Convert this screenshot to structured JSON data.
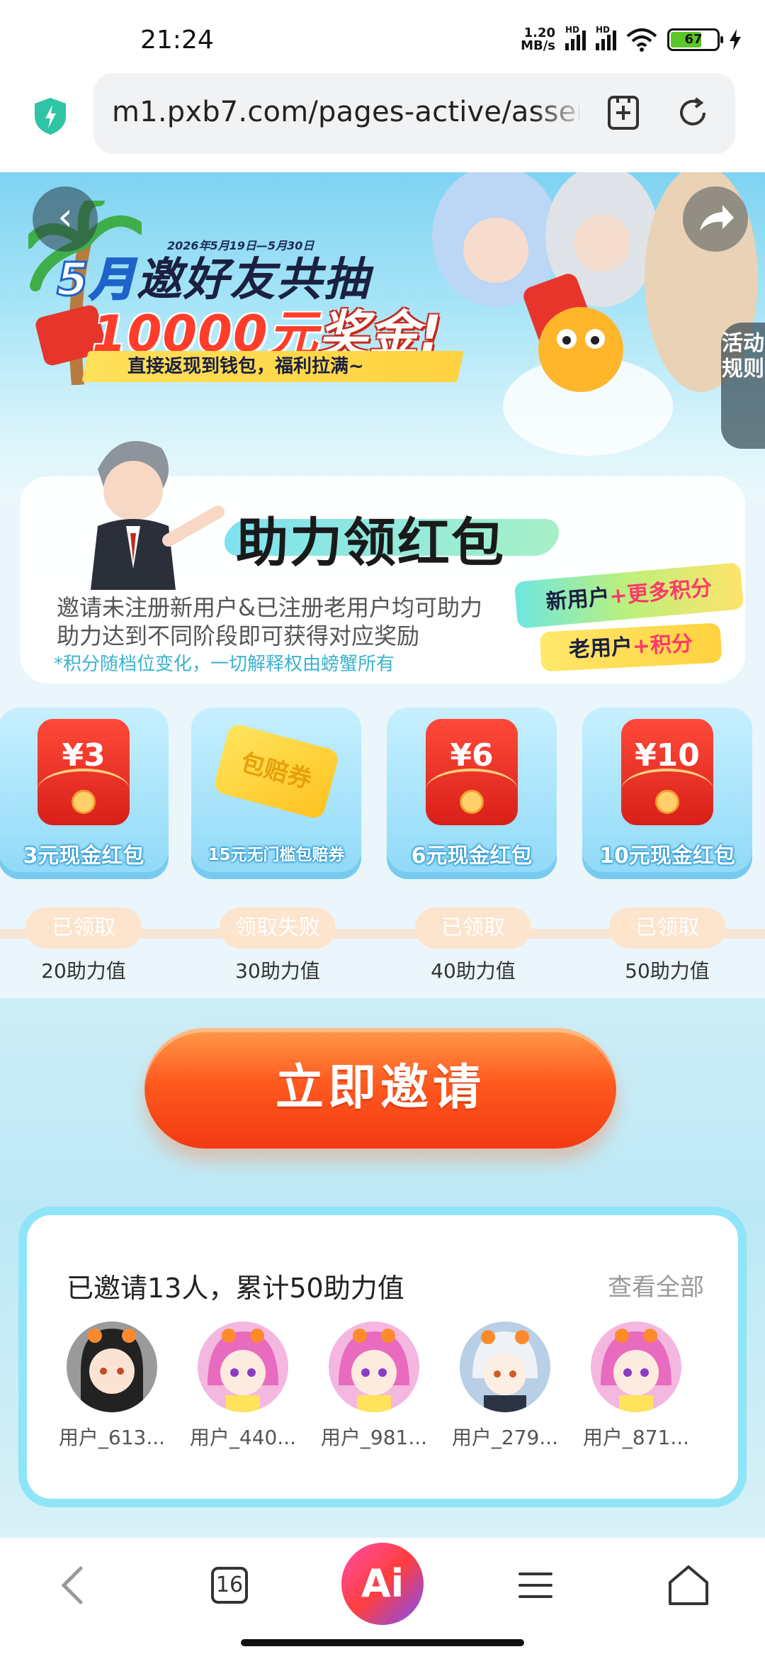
{
  "status_bar": {
    "time": "21:24",
    "net_speed_value": "1.20",
    "net_speed_unit": "MB/s",
    "signal1_label": "HD",
    "signal2_label": "HD",
    "battery": "67",
    "icons": [
      "signal-icon",
      "signal-icon",
      "wifi-icon",
      "battery-icon",
      "charging-icon"
    ]
  },
  "browser": {
    "url": "m1.pxb7.com/pages-active/assen",
    "icons": [
      "shield-icon",
      "add-bookmark-icon",
      "refresh-icon"
    ]
  },
  "banner": {
    "date": "2026年5月19日—5月30日",
    "title_month": "5月",
    "title_line1": "邀好友共抽",
    "title_amount": "10000元",
    "title_line2_suffix": "奖金!",
    "slogan": "直接返现到钱包，福利拉满~",
    "rules_tab": "活动规则"
  },
  "help": {
    "title": "助力领红包",
    "line1": "邀请未注册新用户&已注册老用户均可助力",
    "line2": "助力达到不同阶段即可获得对应奖励",
    "note": "*积分随档位变化，一切解释权由螃蟹所有",
    "tag_new_prefix": "新用户",
    "tag_new_suffix": "+更多积分",
    "tag_old_prefix": "老用户",
    "tag_old_suffix": "+积分"
  },
  "rewards": [
    {
      "amount": "¥3",
      "label": "3元现金红包",
      "status": "已领取",
      "threshold": "20助力值"
    },
    {
      "amount": "包赔券",
      "label": "15元无门槛包赔券",
      "status": "领取失败",
      "threshold": "30助力值"
    },
    {
      "amount": "¥6",
      "label": "6元现金红包",
      "status": "已领取",
      "threshold": "40助力值"
    },
    {
      "amount": "¥10",
      "label": "10元现金红包",
      "status": "已领取",
      "threshold": "50助力值"
    }
  ],
  "invite": {
    "button": "立即邀请",
    "summary": "已邀请13人，累计50助力值",
    "see_all": "查看全部",
    "friends": [
      {
        "name": "用户_613..."
      },
      {
        "name": "用户_440..."
      },
      {
        "name": "用户_981..."
      },
      {
        "name": "用户_279..."
      },
      {
        "name": "用户_871..."
      }
    ]
  },
  "bottom_nav": {
    "tabs_count": "16",
    "ai_label": "Ai",
    "icons": [
      "back-icon",
      "tabs-icon",
      "ai-icon",
      "menu-icon",
      "home-icon"
    ]
  },
  "colors": {
    "accent_orange": "#ff5a1f",
    "sky_blue": "#8fd9f8",
    "red_envelope": "#e8352c",
    "note_blue": "#3ab3cf"
  }
}
